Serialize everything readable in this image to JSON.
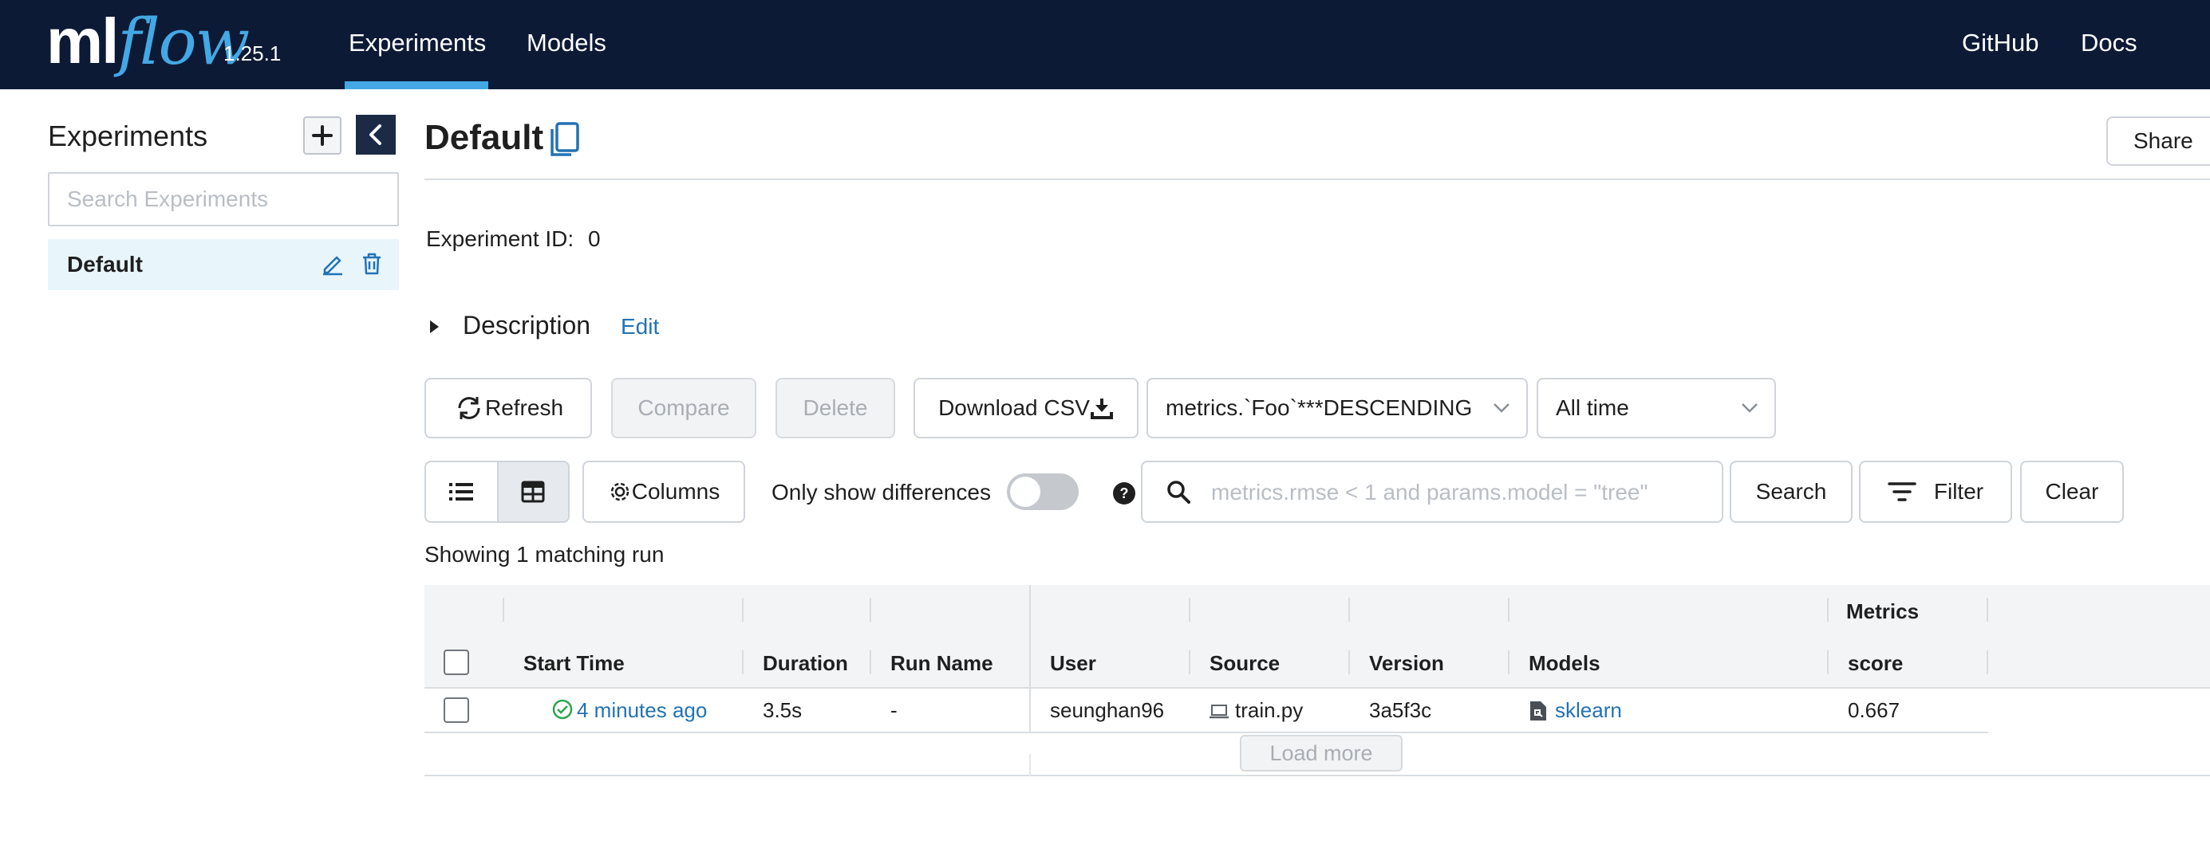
{
  "app": {
    "logo_ml": "ml",
    "logo_flow": "flow",
    "version": "1.25.1"
  },
  "nav": {
    "experiments": "Experiments",
    "models": "Models",
    "github": "GitHub",
    "docs": "Docs"
  },
  "sidebar": {
    "title": "Experiments",
    "search_placeholder": "Search Experiments",
    "items": [
      {
        "name": "Default"
      }
    ]
  },
  "experiment": {
    "name": "Default",
    "id_label": "Experiment ID:",
    "id_value": "0",
    "share": "Share",
    "description_label": "Description",
    "description_edit": "Edit"
  },
  "toolbar": {
    "refresh": "Refresh",
    "compare": "Compare",
    "delete": "Delete",
    "download_csv": "Download CSV",
    "sort_value": "metrics.`Foo`***DESCENDING",
    "time_value": "All time",
    "columns": "Columns",
    "only_show_differences": "Only show differences",
    "search_placeholder": "metrics.rmse < 1 and params.model = \"tree\"",
    "search": "Search",
    "filter": "Filter",
    "clear": "Clear"
  },
  "runs": {
    "summary": "Showing 1 matching run",
    "group_metrics": "Metrics",
    "headers": {
      "start_time": "Start Time",
      "duration": "Duration",
      "run_name": "Run Name",
      "user": "User",
      "source": "Source",
      "version": "Version",
      "models": "Models",
      "score": "score"
    },
    "rows": [
      {
        "start_time": "4 minutes ago",
        "duration": "3.5s",
        "run_name": "-",
        "user": "seunghan96",
        "source": "train.py",
        "version": "3a5f3c",
        "models": "sklearn",
        "score": "0.667"
      }
    ],
    "load_more": "Load more"
  },
  "colors": {
    "topbar": "#0d1a36",
    "accent": "#43a8e4",
    "link": "#2272b4",
    "selected_row": "#e8f5fb",
    "success": "#2ea44f"
  },
  "icons": [
    "plus-icon",
    "chevron-left-icon",
    "edit-icon",
    "trash-icon",
    "copy-icon",
    "caret-right-icon",
    "refresh-icon",
    "download-icon",
    "chevron-down-icon",
    "list-view-icon",
    "table-view-icon",
    "gear-icon",
    "help-icon",
    "search-icon",
    "filter-icon",
    "check-circle-icon",
    "laptop-icon",
    "model-file-icon"
  ]
}
